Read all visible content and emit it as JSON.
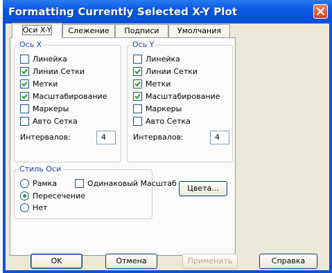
{
  "window": {
    "title": "Formatting Currently Selected X-Y Plot"
  },
  "tabs": [
    {
      "label": "Оси X-Y"
    },
    {
      "label": "Слежение"
    },
    {
      "label": "Подписи"
    },
    {
      "label": "Умолчания"
    }
  ],
  "axis_x": {
    "title": "Ось X",
    "options": [
      {
        "label": "Линейка",
        "checked": false
      },
      {
        "label": "Линии Сетки",
        "checked": true
      },
      {
        "label": "Метки",
        "checked": true
      },
      {
        "label": "Масштабирование",
        "checked": true
      },
      {
        "label": "Маркеры",
        "checked": false
      },
      {
        "label": "Авто Сетка",
        "checked": false
      }
    ],
    "intervals_label": "Интервалов:",
    "intervals_value": "4"
  },
  "axis_y": {
    "title": "Ось Y",
    "options": [
      {
        "label": "Линейка",
        "checked": false
      },
      {
        "label": "Линии Сетки",
        "checked": true
      },
      {
        "label": "Метки",
        "checked": true
      },
      {
        "label": "Масштабирование",
        "checked": true
      },
      {
        "label": "Маркеры",
        "checked": false
      },
      {
        "label": "Авто Сетка",
        "checked": false
      }
    ],
    "intervals_label": "Интервалов:",
    "intervals_value": "4"
  },
  "axis_style": {
    "title": "Стиль Оси",
    "frame_label": "Рамка",
    "crossing_label": "Пересечение",
    "none_label": "Нет",
    "selected": "crossing",
    "same_scale_label": "Одинаковый Масштаб",
    "same_scale_checked": false
  },
  "colors_button": "Цвета...",
  "buttons": {
    "ok": "OK",
    "cancel": "Отмена",
    "apply": "Применить",
    "help": "Справка"
  }
}
